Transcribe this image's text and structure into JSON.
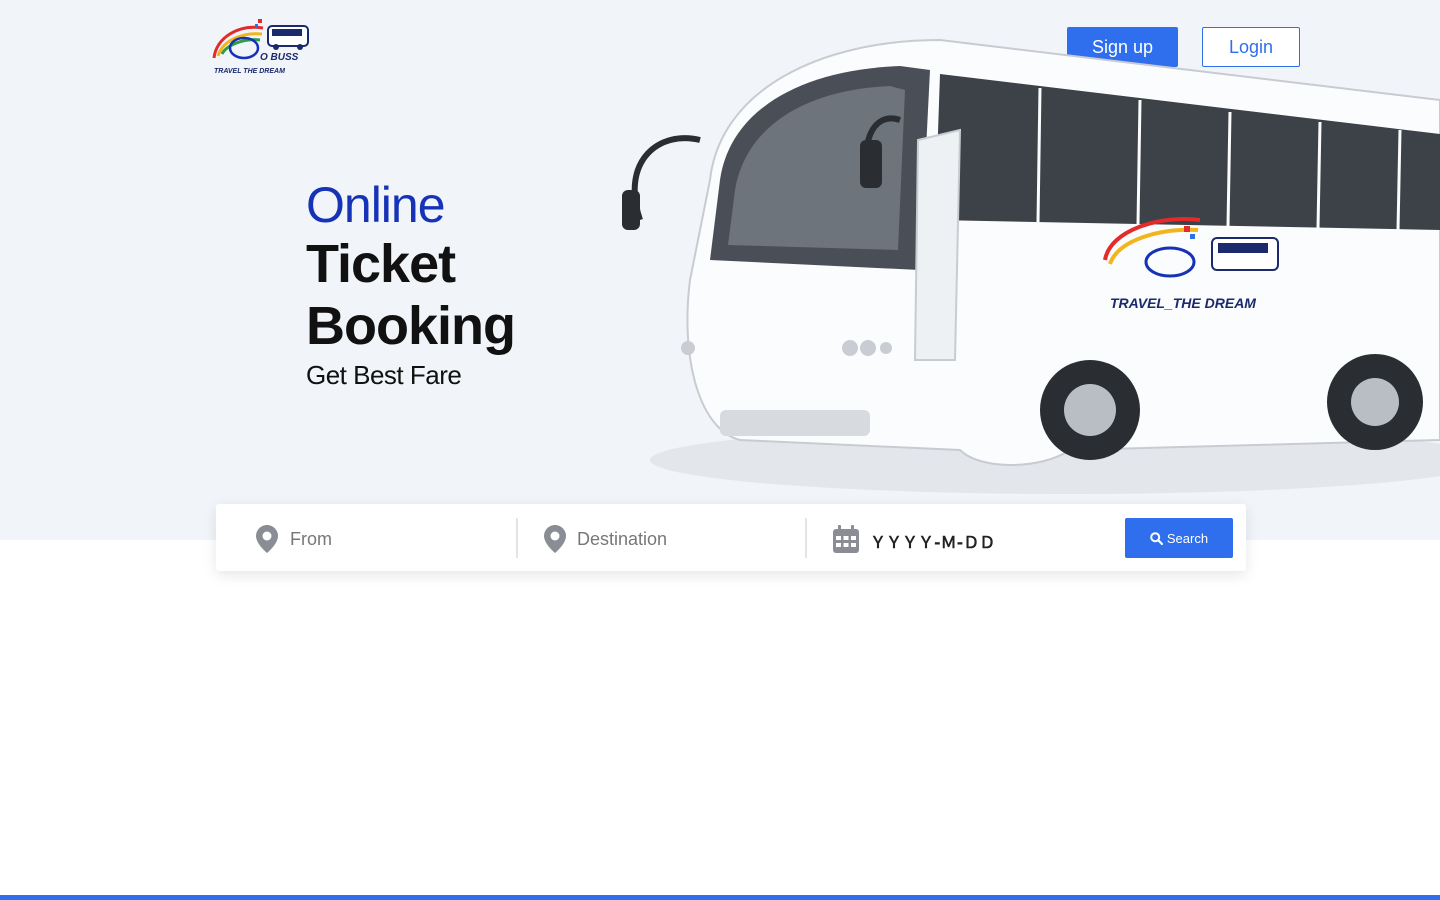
{
  "header": {
    "logo": {
      "icon": "bus-brand-logo-icon",
      "brand_text": "O BUSS",
      "tagline": "TRAVEL THE DREAM"
    },
    "signup_label": "Sign up",
    "login_label": "Login"
  },
  "hero": {
    "line1": "Online",
    "line2": "Ticket",
    "line3": "Booking",
    "line4": "Get Best Fare",
    "image": "white-coach-bus-image"
  },
  "search": {
    "from_placeholder": "From",
    "from_icon": "map-pin-icon",
    "destination_placeholder": "Destination",
    "destination_icon": "map-pin-icon",
    "date_value": "ＹＹＹＹ-Ｍ-ＤＤ",
    "date_icon": "calendar-icon",
    "search_label": "Search",
    "search_icon": "search-icon"
  },
  "colors": {
    "accent": "#2f6fee",
    "hero_bg": "#f1f5f9",
    "headline_blue": "#1633b8"
  }
}
